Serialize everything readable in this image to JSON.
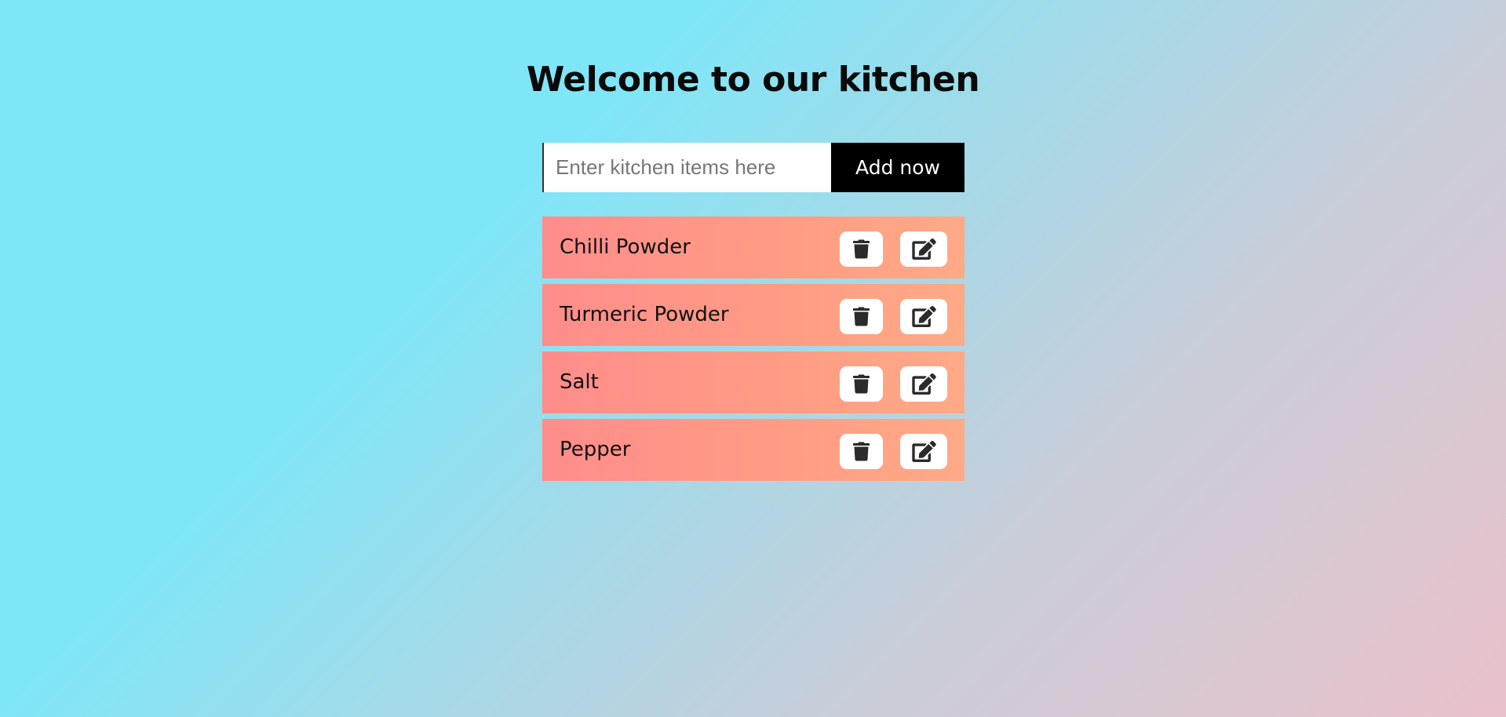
{
  "header": {
    "title": "Welcome to our kitchen"
  },
  "form": {
    "input_value": "",
    "placeholder": "Enter kitchen items here",
    "add_label": "Add now"
  },
  "items": [
    {
      "label": "Chilli Powder",
      "delete_icon": "trash-icon",
      "edit_icon": "edit-icon"
    },
    {
      "label": "Turmeric Powder",
      "delete_icon": "trash-icon",
      "edit_icon": "edit-icon"
    },
    {
      "label": "Salt",
      "delete_icon": "trash-icon",
      "edit_icon": "edit-icon"
    },
    {
      "label": "Pepper",
      "delete_icon": "trash-icon",
      "edit_icon": "edit-icon"
    }
  ],
  "colors": {
    "background_start": "#7fe6f8",
    "background_end": "#eac2cb",
    "item_start": "#ff8d8b",
    "item_end": "#ffaa86",
    "button": "#000000",
    "icon": "#2b2b2b"
  }
}
